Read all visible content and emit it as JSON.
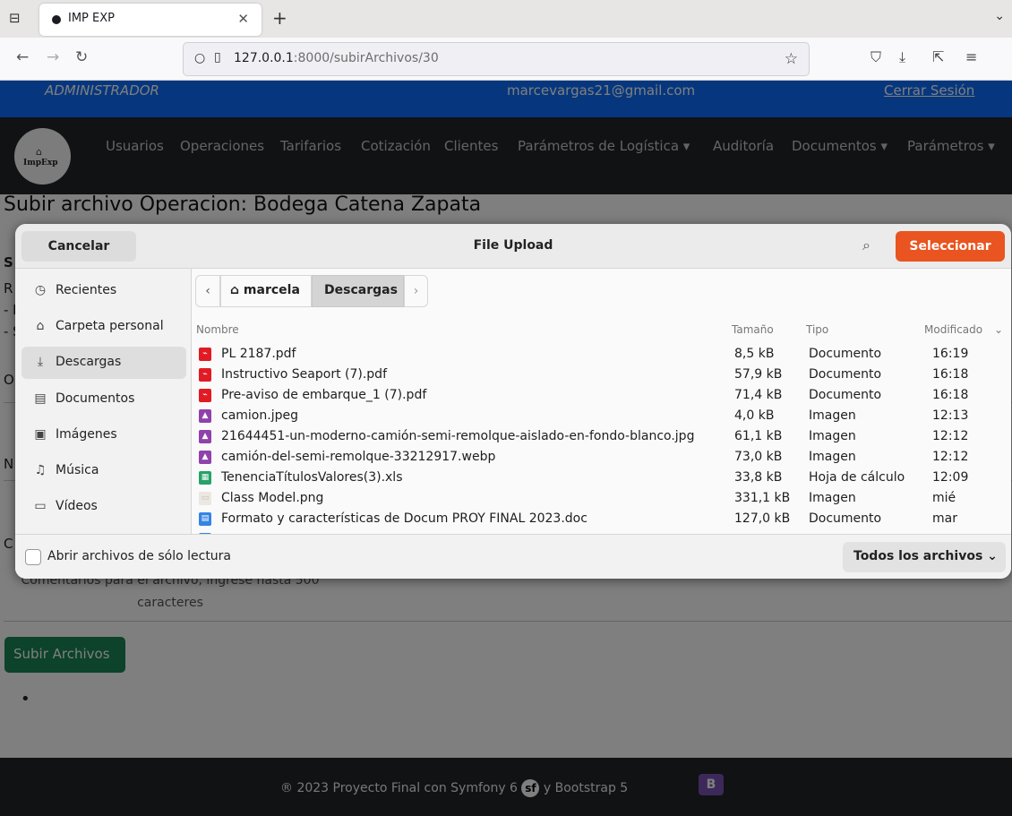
{
  "browser": {
    "tab_title": "IMP EXP",
    "url_host": "127.0.0.1",
    "url_path": ":8000/subirArchivos/30"
  },
  "site": {
    "role": "ADMINISTRADOR",
    "email": "marcevargas21@gmail.com",
    "logout": "Cerrar Sesión",
    "logo_text": "ImpExp",
    "menu": [
      {
        "label": "Usuarios"
      },
      {
        "label": "Operaciones"
      },
      {
        "label": "Tarifarios"
      },
      {
        "label": "Cotización"
      },
      {
        "label": "Clientes"
      },
      {
        "label": "Parámetros de Logística ▾"
      },
      {
        "label": "Auditoría"
      },
      {
        "label": "Documentos ▾"
      },
      {
        "label": "Parámetros ▾"
      }
    ],
    "page_title": "Subir archivo Operacion: Bodega Catena Zapata",
    "comments_hint": "Comentarios para el archivo, ingrese hasta 500 caracteres",
    "submit_label": "Subir Archivos",
    "footer_text_a": "® 2023 Proyecto Final con Symfony 6",
    "footer_text_b": "y Bootstrap 5",
    "bg_fragments": {
      "s": "S",
      "r": "R",
      "dash1": "- I",
      "dash2": "- S",
      "o": "O",
      "n": "N",
      "c": "C"
    }
  },
  "dialog": {
    "title": "File Upload",
    "cancel": "Cancelar",
    "select": "Seleccionar",
    "sidebar": [
      {
        "label": "Recientes",
        "icon": "clock-icon"
      },
      {
        "label": "Carpeta personal",
        "icon": "home-icon"
      },
      {
        "label": "Descargas",
        "icon": "download-icon"
      },
      {
        "label": "Documentos",
        "icon": "document-icon"
      },
      {
        "label": "Imágenes",
        "icon": "image-icon"
      },
      {
        "label": "Música",
        "icon": "music-icon"
      },
      {
        "label": "Vídeos",
        "icon": "video-icon"
      }
    ],
    "path": {
      "home": "marcela",
      "current": "Descargas"
    },
    "columns": {
      "name": "Nombre",
      "size": "Tamaño",
      "type": "Tipo",
      "modified": "Modificado"
    },
    "files": [
      {
        "name": "PL 2187.pdf",
        "size": "8,5 kB",
        "type": "Documento",
        "modified": "16:19",
        "kind": "pdf"
      },
      {
        "name": "Instructivo Seaport (7).pdf",
        "size": "57,9 kB",
        "type": "Documento",
        "modified": "16:18",
        "kind": "pdf"
      },
      {
        "name": "Pre-aviso de embarque_1 (7).pdf",
        "size": "71,4 kB",
        "type": "Documento",
        "modified": "16:18",
        "kind": "pdf"
      },
      {
        "name": "camion.jpeg",
        "size": "4,0 kB",
        "type": "Imagen",
        "modified": "12:13",
        "kind": "image"
      },
      {
        "name": "21644451-un-moderno-camión-semi-remolque-aislado-en-fondo-blanco.jpg",
        "size": "61,1 kB",
        "type": "Imagen",
        "modified": "12:12",
        "kind": "image"
      },
      {
        "name": "camión-del-semi-remolque-33212917.webp",
        "size": "73,0 kB",
        "type": "Imagen",
        "modified": "12:12",
        "kind": "image"
      },
      {
        "name": "TenenciaTítulosValores(3).xls",
        "size": "33,8 kB",
        "type": "Hoja de cálculo",
        "modified": "12:09",
        "kind": "sheet"
      },
      {
        "name": "Class Model.png",
        "size": "331,1 kB",
        "type": "Imagen",
        "modified": "mié",
        "kind": "thumb"
      },
      {
        "name": "Formato y características de Docum PROY FINAL 2023.doc",
        "size": "127,0 kB",
        "type": "Documento",
        "modified": "mar",
        "kind": "doc"
      }
    ],
    "readonly_label": "Abrir archivos de sólo lectura",
    "filter": "Todos los archivos"
  },
  "colors": {
    "accent": "#e95420",
    "pdf": "#e01b24",
    "image": "#9141ac",
    "sheet": "#26a269",
    "doc": "#3584e4",
    "site_blue": "#0d6efd",
    "dark": "#212529"
  }
}
